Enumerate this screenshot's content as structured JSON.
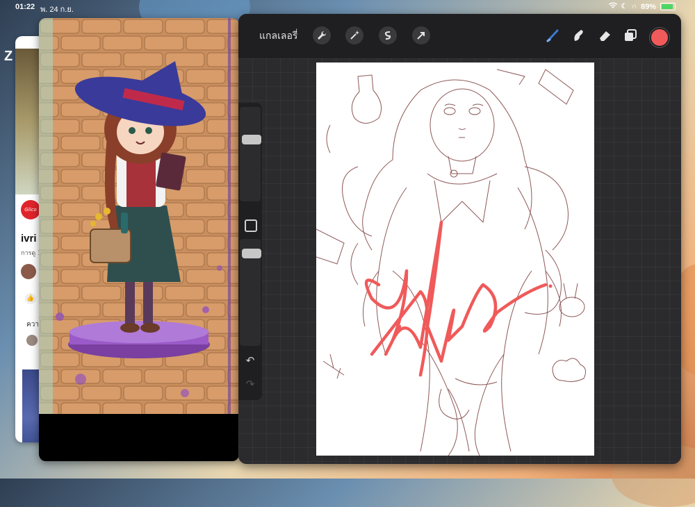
{
  "status_bar": {
    "time": "01:22",
    "date": "พ. 24 ก.ย.",
    "battery": "89%"
  },
  "back_app": {
    "logo_text": "Glico",
    "title": "ivri",
    "subtitle": "การดู 1",
    "comment_prefix": "ควา",
    "side_text": "Z"
  },
  "procreate": {
    "gallery_label": "แกลเลอรี่",
    "active_color": "#f05a5a",
    "accent_color": "#3a7bd5"
  },
  "icons": {
    "actions": "wrench-icon",
    "adjustments": "magic-wand-icon",
    "selection": "selection-s-icon",
    "transform": "arrow-cursor-icon",
    "brush": "brush-icon",
    "smudge": "smudge-finger-icon",
    "eraser": "eraser-icon",
    "layers": "layers-icon",
    "undo": "undo-icon",
    "redo": "redo-icon"
  }
}
